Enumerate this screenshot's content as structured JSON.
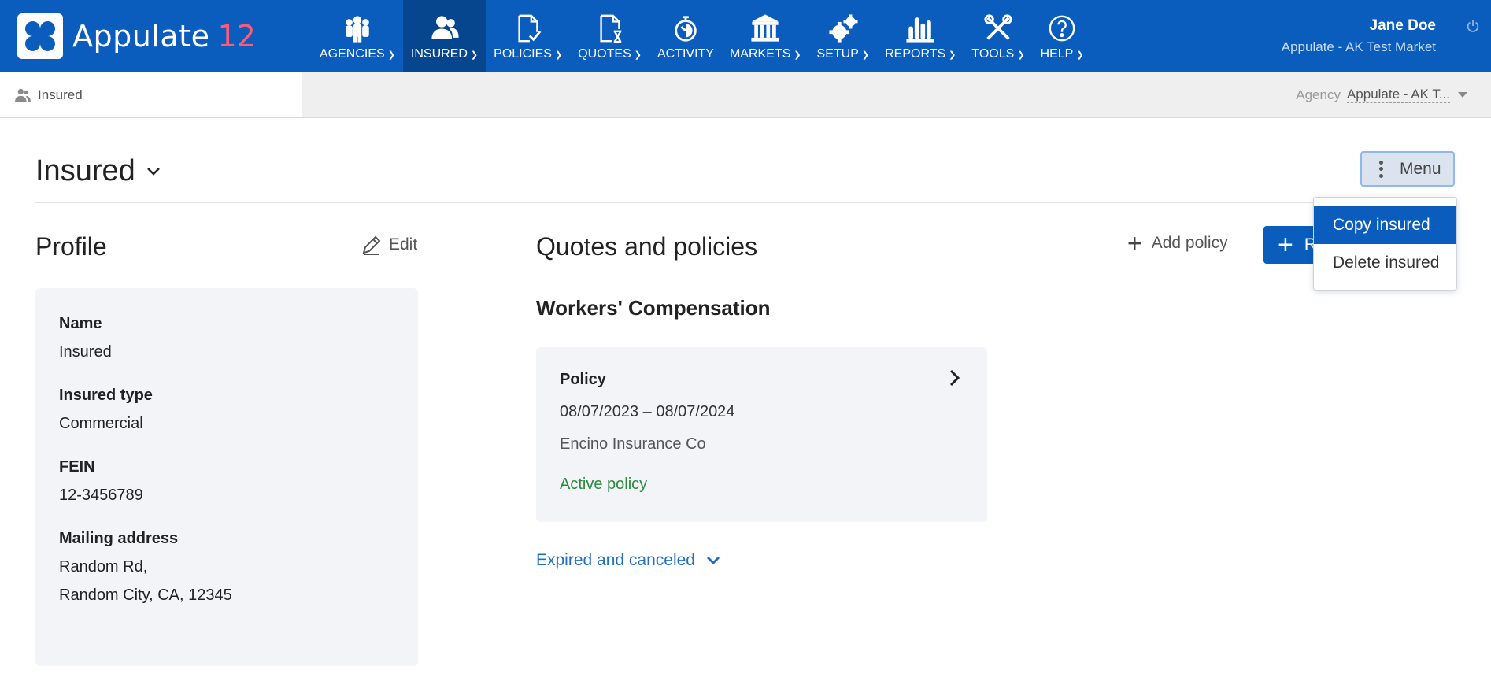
{
  "app": {
    "name": "Appulate",
    "version": "12"
  },
  "nav": {
    "items": [
      {
        "label": "AGENCIES",
        "icon": "people-group-icon"
      },
      {
        "label": "INSURED",
        "icon": "users-icon"
      },
      {
        "label": "POLICIES",
        "icon": "document-check-icon"
      },
      {
        "label": "QUOTES",
        "icon": "document-hourglass-icon"
      },
      {
        "label": "ACTIVITY",
        "icon": "stopwatch-icon"
      },
      {
        "label": "MARKETS",
        "icon": "bank-icon"
      },
      {
        "label": "SETUP",
        "icon": "gears-icon"
      },
      {
        "label": "REPORTS",
        "icon": "bar-chart-icon"
      },
      {
        "label": "TOOLS",
        "icon": "tools-icon"
      },
      {
        "label": "HELP",
        "icon": "help-circle-icon"
      }
    ],
    "active": "INSURED"
  },
  "user": {
    "name": "Jane Doe",
    "organization": "Appulate - AK Test Market"
  },
  "subheader": {
    "breadcrumb": "Insured",
    "agency_label": "Agency",
    "agency_value": "Appulate - AK T..."
  },
  "page": {
    "title": "Insured",
    "menu_label": "Menu"
  },
  "menu_dropdown": {
    "items": [
      "Copy insured",
      "Delete insured"
    ],
    "selected": "Copy insured"
  },
  "profile": {
    "title": "Profile",
    "edit_label": "Edit",
    "fields": [
      {
        "label": "Name",
        "value": "Insured"
      },
      {
        "label": "Insured type",
        "value": "Commercial"
      },
      {
        "label": "FEIN",
        "value": "12-3456789"
      },
      {
        "label": "Mailing address",
        "value_line1": "Random Rd,",
        "value_line2": "Random City, CA, 12345"
      }
    ]
  },
  "quotes_policies": {
    "title": "Quotes and policies",
    "add_policy_label": "Add policy",
    "primary_button_label": "R",
    "section_title": "Workers' Compensation",
    "policy_card": {
      "title": "Policy",
      "dates": "08/07/2023 – 08/07/2024",
      "carrier": "Encino Insurance Co",
      "status": "Active policy"
    },
    "expired_label": "Expired and canceled"
  },
  "colors": {
    "brand_blue": "#0a5dbd",
    "nav_active": "#06468f",
    "version_accent": "#ff5a7a",
    "status_active": "#2b8a3e",
    "link": "#1f6fc6"
  }
}
